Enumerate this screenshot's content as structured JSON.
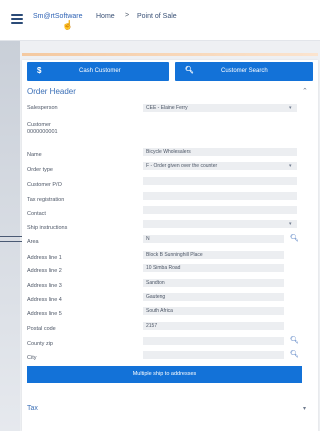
{
  "header": {
    "menu_icon": "hamburger-icon",
    "app_name": "Sm@rtSoftware",
    "crumb_home": "Home",
    "crumb_sep": ">",
    "crumb_page": "Point of Sale"
  },
  "buttons": {
    "cash_icon": "$",
    "cash_label": "Cash Customer",
    "search_icon": "search-icon",
    "search_label": "Customer Search"
  },
  "order_header": {
    "title": "Order Header",
    "fields": [
      {
        "label": "Salesperson",
        "value": "CEE - Elaine Ferry",
        "dropdown": true
      },
      {
        "label": "Customer",
        "value": ""
      },
      {
        "label": "0000000001",
        "value": ""
      },
      {
        "label": "Name",
        "value": "Bicycle Wholesalers"
      },
      {
        "label": "Order type",
        "value": "F - Order given over the counter",
        "dropdown": true
      },
      {
        "label": "Customer P/O",
        "value": ""
      },
      {
        "label": "Tax registration",
        "value": ""
      },
      {
        "label": "Contact",
        "value": ""
      },
      {
        "label": "Ship instructions",
        "value": "",
        "dropdown": true
      },
      {
        "label": "Area",
        "value": "N",
        "search": true
      },
      {
        "label": "Address line 1",
        "value": "Block B Sunninghill Place"
      },
      {
        "label": "Address line 2",
        "value": "10 Simba Road"
      },
      {
        "label": "Address line 3",
        "value": "Sandton"
      },
      {
        "label": "Address line 4",
        "value": "Gauteng"
      },
      {
        "label": "Address line 5",
        "value": "South Africa"
      },
      {
        "label": "Postal code",
        "value": "2157"
      },
      {
        "label": "County zip",
        "value": "",
        "search": true
      },
      {
        "label": "City",
        "value": "",
        "search": true
      }
    ],
    "multi_button": "Multiple ship to addresses"
  },
  "tax": {
    "title": "Tax"
  }
}
